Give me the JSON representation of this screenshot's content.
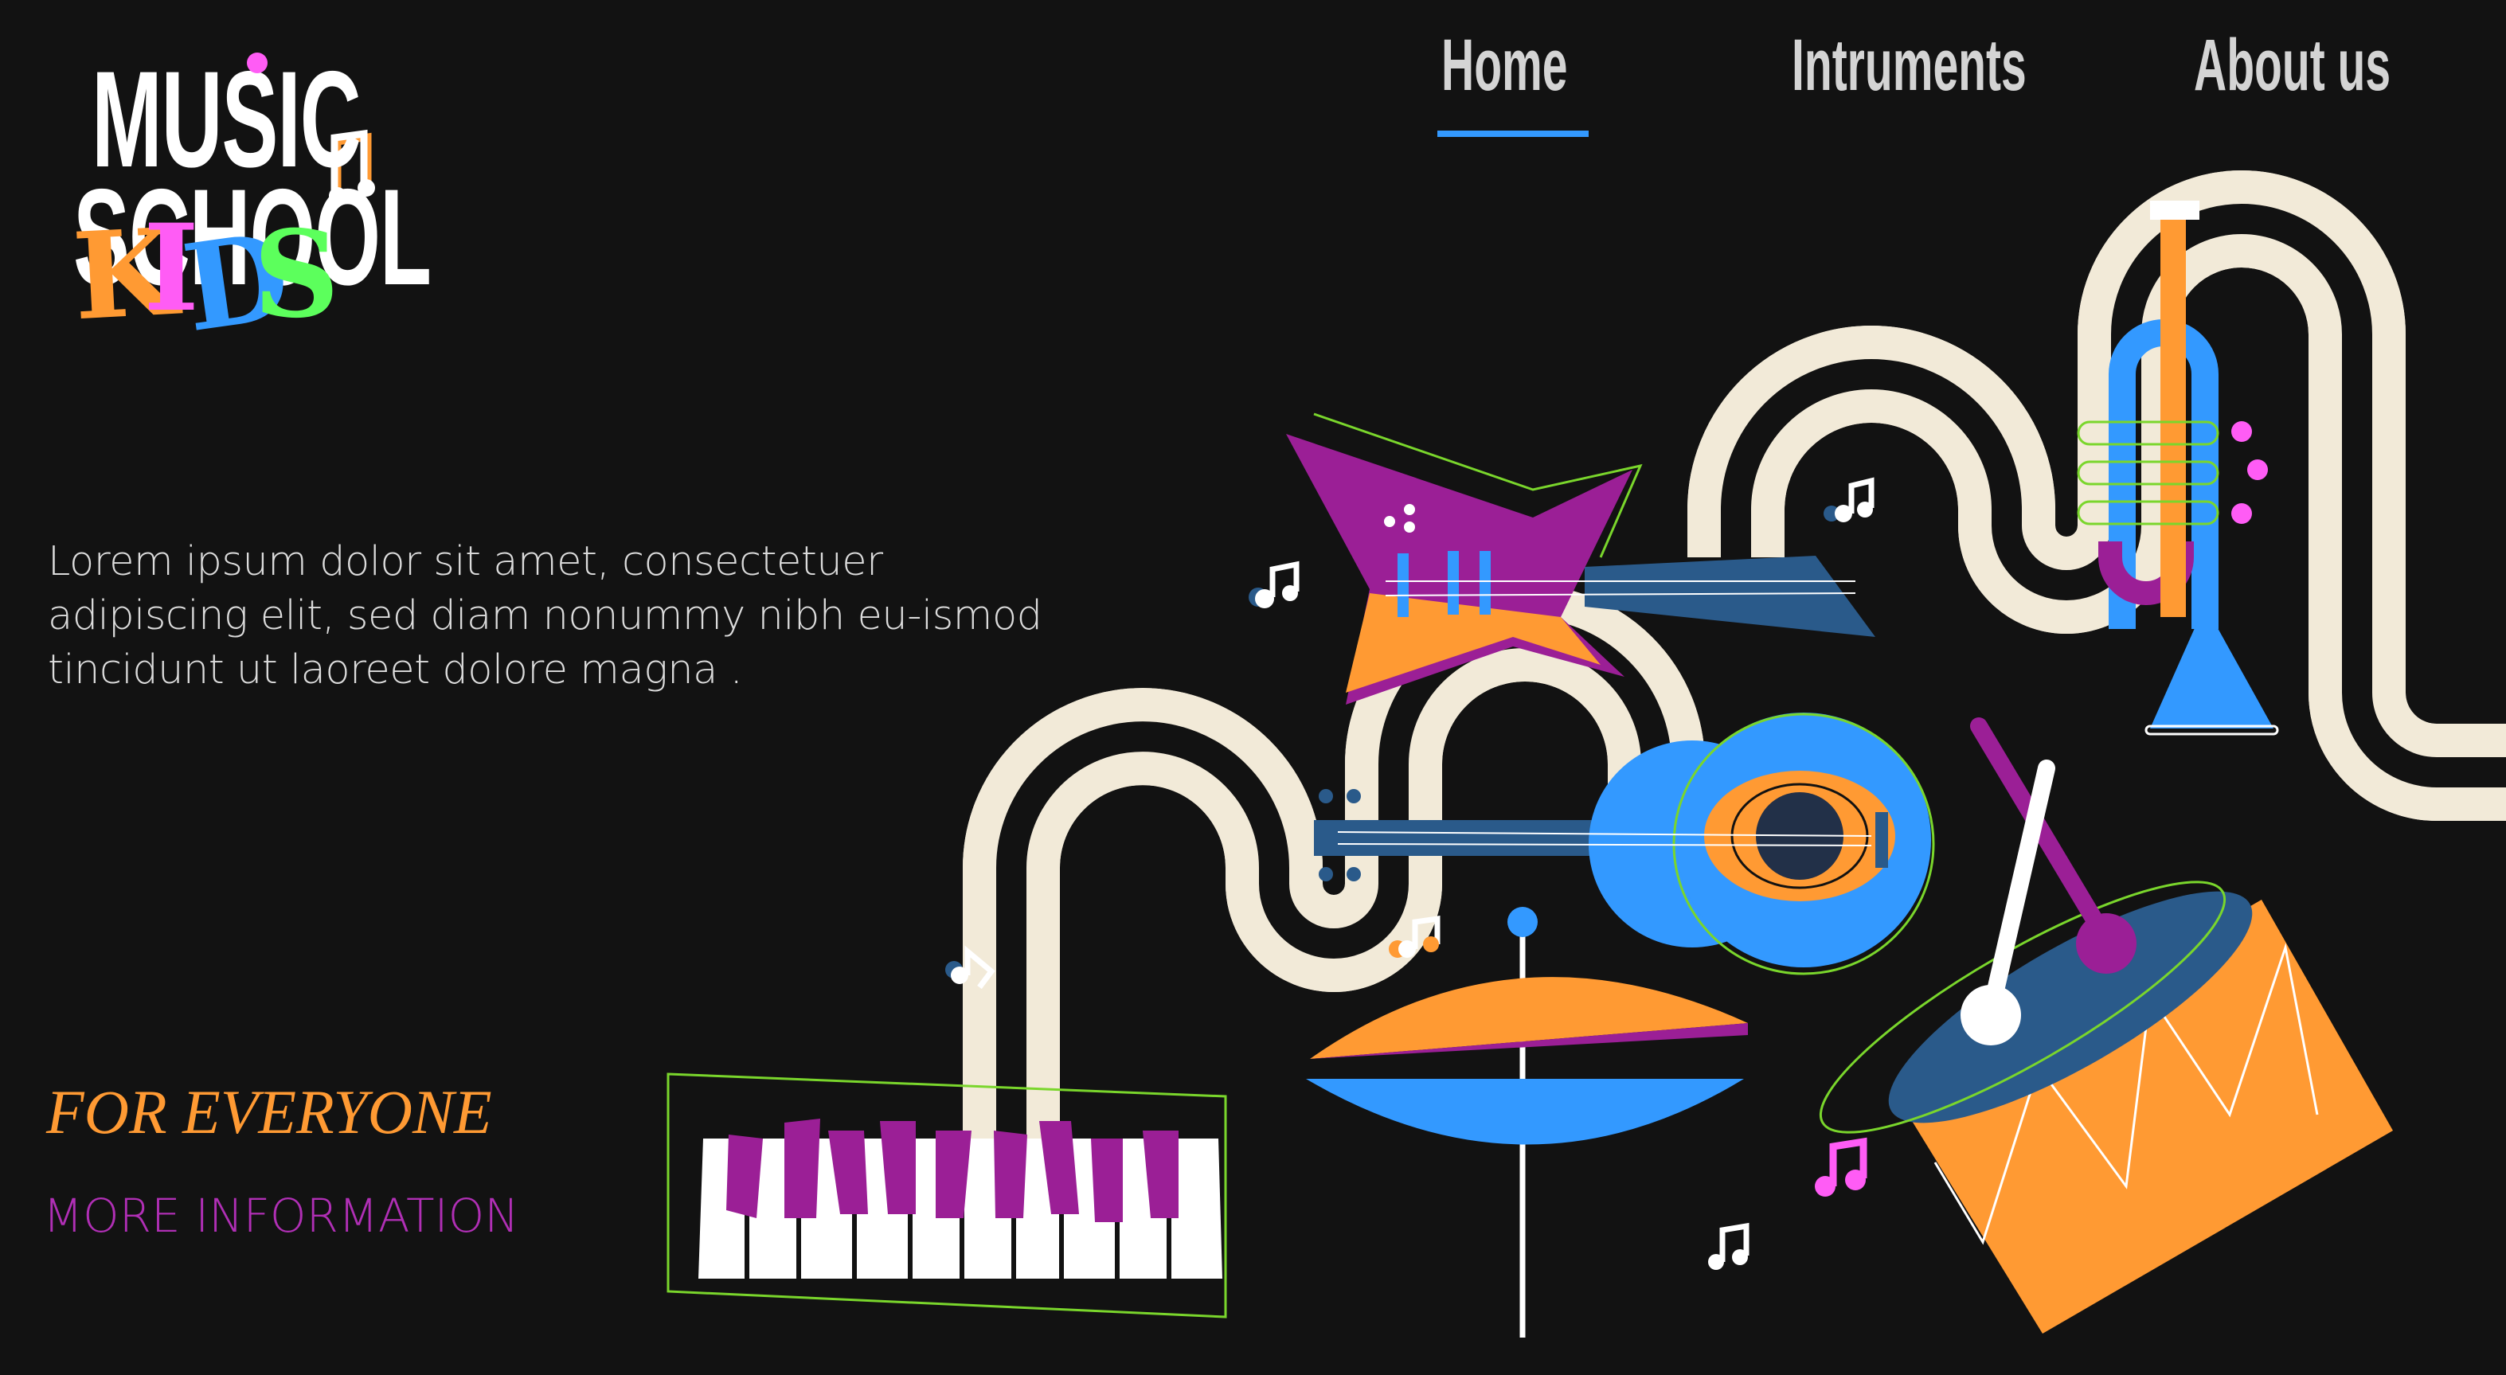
{
  "logo": {
    "line1": "MUSIC",
    "line2": "SCHOOL",
    "kids_letters": [
      "K",
      "I",
      "D",
      "S"
    ]
  },
  "nav": {
    "items": [
      {
        "label": "Home",
        "active": true
      },
      {
        "label": "Intruments",
        "active": false
      },
      {
        "label": "About us",
        "active": false
      }
    ]
  },
  "hero": {
    "intro": "Lorem ipsum dolor sit amet, consectetuer adipiscing elit, sed diam nonummy nibh eu-ismod tincidunt ut laoreet dolore magna .",
    "tagline": "FOR EVERYONE",
    "more_link": "MORE INFORMATION"
  },
  "colors": {
    "background": "#121212",
    "accent_blue": "#3399ff",
    "orange": "#ff9a33",
    "purple": "#9b1f96",
    "pink": "#ff5cf5",
    "green": "#5cff5c"
  }
}
